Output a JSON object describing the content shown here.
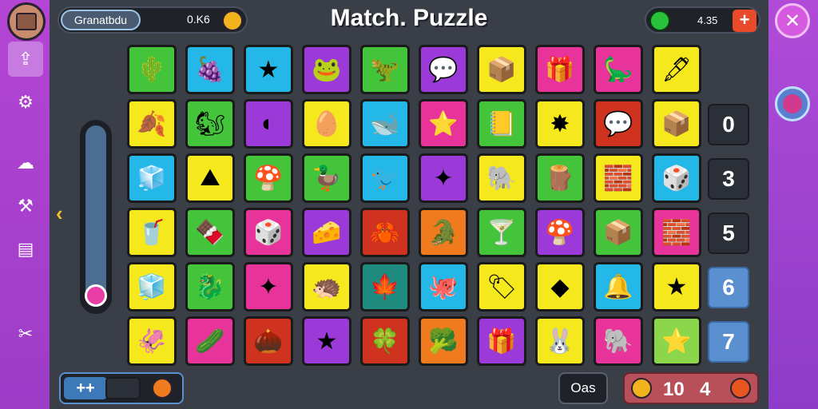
{
  "header": {
    "title": "Match. Puzzle",
    "player_name": "Granatbdu",
    "score": "0.K6",
    "gems": "4.35",
    "add_label": "+"
  },
  "sidebar_left": {
    "icons": [
      "upload-icon",
      "settings-icon",
      "cloud-icon",
      "hammer-icon",
      "calendar-icon",
      "tools-icon"
    ]
  },
  "sidebar_right": {
    "close_label": "✕"
  },
  "board": {
    "tiles": [
      [
        {
          "c": "#43c43a",
          "g": "🌵"
        },
        {
          "c": "#24b8e8",
          "g": "🍇"
        },
        {
          "c": "#24b8e8",
          "g": "★"
        },
        {
          "c": "#9b3ad8",
          "g": "🐸"
        },
        {
          "c": "#43c43a",
          "g": "🦖"
        },
        {
          "c": "#9b3ad8",
          "g": "💬"
        },
        {
          "c": "#f5e81c",
          "g": "📦"
        },
        {
          "c": "#e8349a",
          "g": "🎁"
        },
        {
          "c": "#e8349a",
          "g": "🦕"
        },
        {
          "c": "#f5e81c",
          "g": "🖋"
        }
      ],
      [
        {
          "c": "#f5e81c",
          "g": "🍂"
        },
        {
          "c": "#43c43a",
          "g": "🐿"
        },
        {
          "c": "#9b3ad8",
          "g": "◐"
        },
        {
          "c": "#f5e81c",
          "g": "🥚"
        },
        {
          "c": "#24b8e8",
          "g": "🐋"
        },
        {
          "c": "#e8349a",
          "g": "⭐"
        },
        {
          "c": "#43c43a",
          "g": "📒"
        },
        {
          "c": "#f5e81c",
          "g": "✸"
        },
        {
          "c": "#d03220",
          "g": "💬"
        },
        {
          "c": "#f5e81c",
          "g": "📦"
        }
      ],
      [
        {
          "c": "#24b8e8",
          "g": "🧊"
        },
        {
          "c": "#f5e81c",
          "g": "⛰"
        },
        {
          "c": "#43c43a",
          "g": "🍄"
        },
        {
          "c": "#43c43a",
          "g": "🦆"
        },
        {
          "c": "#24b8e8",
          "g": "🐦"
        },
        {
          "c": "#9b3ad8",
          "g": "✦"
        },
        {
          "c": "#f5e81c",
          "g": "🐘"
        },
        {
          "c": "#43c43a",
          "g": "🪵"
        },
        {
          "c": "#f5e81c",
          "g": "🧱"
        },
        {
          "c": "#24b8e8",
          "g": "🎲"
        }
      ],
      [
        {
          "c": "#f5e81c",
          "g": "🥤"
        },
        {
          "c": "#43c43a",
          "g": "🍫"
        },
        {
          "c": "#e8349a",
          "g": "🎲"
        },
        {
          "c": "#9b3ad8",
          "g": "🧀"
        },
        {
          "c": "#d03220",
          "g": "🦀"
        },
        {
          "c": "#f07a1e",
          "g": "🐊"
        },
        {
          "c": "#43c43a",
          "g": "🍸"
        },
        {
          "c": "#9b3ad8",
          "g": "🍄"
        },
        {
          "c": "#43c43a",
          "g": "📦"
        },
        {
          "c": "#e8349a",
          "g": "🧱"
        }
      ],
      [
        {
          "c": "#f5e81c",
          "g": "🧊"
        },
        {
          "c": "#43c43a",
          "g": "🐉"
        },
        {
          "c": "#e8349a",
          "g": "✦"
        },
        {
          "c": "#f5e81c",
          "g": "🦔"
        },
        {
          "c": "#1f8a7e",
          "g": "🍁"
        },
        {
          "c": "#24b8e8",
          "g": "🐙"
        },
        {
          "c": "#f5e81c",
          "g": "🏷"
        },
        {
          "c": "#f5e81c",
          "g": "◆"
        },
        {
          "c": "#24b8e8",
          "g": "🔔"
        },
        {
          "c": "#f5e81c",
          "g": "★"
        }
      ],
      [
        {
          "c": "#f5e81c",
          "g": "🦑"
        },
        {
          "c": "#e8349a",
          "g": "🥒"
        },
        {
          "c": "#d03220",
          "g": "🌰"
        },
        {
          "c": "#9b3ad8",
          "g": "★"
        },
        {
          "c": "#d03220",
          "g": "🍀"
        },
        {
          "c": "#f07a1e",
          "g": "🥦"
        },
        {
          "c": "#9b3ad8",
          "g": "🎁"
        },
        {
          "c": "#f5e81c",
          "g": "🐰"
        },
        {
          "c": "#e8349a",
          "g": "🐘"
        },
        {
          "c": "#8bd64a",
          "g": "⭐"
        }
      ]
    ],
    "side_numbers": [
      "0",
      "3",
      "5",
      "6",
      "7"
    ]
  },
  "footer": {
    "toggle_label": "++",
    "mode_label": "Oas",
    "count_a": "10",
    "count_b": "4"
  }
}
